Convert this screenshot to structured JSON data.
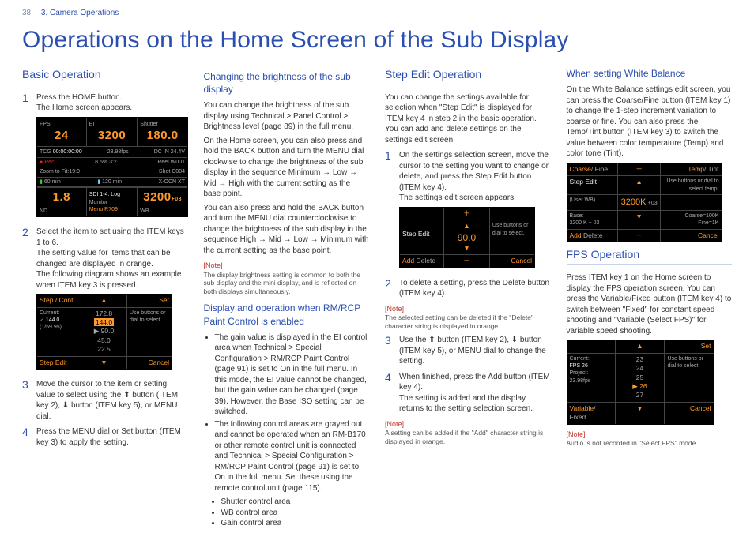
{
  "header": {
    "page": "38",
    "chapter": "3. Camera Operations"
  },
  "title": "Operations on the Home Screen of the Sub Display",
  "col1": {
    "h": "Basic Operation",
    "s1": {
      "n": "1",
      "a": "Press the HOME button.",
      "b": "The Home screen appears."
    },
    "lcd": {
      "fps_l": "FPS",
      "fps_v": "24",
      "ei_l": "EI",
      "ei_v": "3200",
      "sh_l": "Shutter",
      "sh_v": "180.0",
      "tcg": "TCG",
      "tc": "00:00:00:00",
      "fmt": "23.98fps",
      "dc": "DC IN 24.4V",
      "rec": "Rec",
      "gb": "8.6% 3:2",
      "zoom": "Zoom to Fit:19:9",
      "reel": "Reel W001",
      "shot": "Shot C004",
      "cache": "60 min",
      "play": "120 min",
      "xocn": "X-OCN XT",
      "nd_v": "1.8",
      "nd_l": "ND",
      "sdi": "SDI 1-4: Log",
      "lut": "Monitor",
      "menu": "Menu R709",
      "wb_v": "3200",
      "wb_off": "+03",
      "wb_l": "WB"
    },
    "s2": {
      "n": "2",
      "a": "Select the item to set using the ITEM keys 1 to 6.",
      "b": "The setting value for items that can be changed are displayed in orange.",
      "c": "The following diagram shows an example when ITEM key 3 is pressed."
    },
    "lcd2": {
      "tl": "Step / Cont.",
      "set": "Set",
      "cur": "Current:",
      "ang": "⊿ 144.0",
      "rate": "(1/59.95)",
      "v1": "172.8",
      "v2": "144.0",
      "v3": "90.0",
      "v4": "45.0",
      "v5": "22.5",
      "hint": "Use buttons or dial to select.",
      "se": "Step Edit",
      "cancel": "Cancel"
    },
    "s3": {
      "n": "3",
      "a": "Move the cursor to the item or setting value to select using the ⬆ button (ITEM key 2), ⬇ button (ITEM key 5), or MENU dial."
    },
    "s4": {
      "n": "4",
      "a": "Press the MENU dial or Set button (ITEM key 3) to apply the setting."
    }
  },
  "col2": {
    "h1": "Changing the brightness of the sub display",
    "p1": "You can change the brightness of the sub display using Technical > Panel Control > Brightness level (page 89) in the full menu.",
    "p2": "On the Home screen, you can also press and hold the BACK button and turn the MENU dial clockwise to change the brightness of the sub display in the sequence Minimum → Low → Mid → High with the current setting as the base point.",
    "p3": "You can also press and hold the BACK button and turn the MENU dial counterclockwise to change the brightness of the sub display in the sequence High → Mid → Low → Minimum with the current setting as the base point.",
    "noteL": "[Note]",
    "noteT": "The display brightness setting is common to both the sub display and the mini display, and is reflected on both displays simultaneously.",
    "h2": "Display and operation when RM/RCP Paint Control is enabled",
    "b1": "The gain value is displayed in the EI control area when Technical > Special Configuration > RM/RCP Paint Control (page 91) is set to On in the full menu. In this mode, the EI value cannot be changed, but the gain value can be changed (page 39). However, the Base ISO setting can be switched.",
    "b2": "The following control areas are grayed out and cannot be operated when an RM-B170 or other remote control unit is connected and Technical > Special Configuration > RM/RCP Paint Control (page 91) is set to On in the full menu. Set these using the remote control unit (page 115).",
    "bb1": "Shutter control area",
    "bb2": "WB control area",
    "bb3": "Gain control area"
  },
  "col3": {
    "h": "Step Edit Operation",
    "intro": "You can change the settings available for selection when \"Step Edit\" is displayed for ITEM key 4 in step 2 in the basic operation. You can add and delete settings on the settings edit screen.",
    "s1": {
      "n": "1",
      "a": "On the settings selection screen, move the cursor to the setting you want to change or delete, and press the Step Edit button (ITEM key 4).",
      "b": "The settings edit screen appears."
    },
    "lcd": {
      "tl": "Step Edit",
      "plus": "＋",
      "up": "▲",
      "v": "90.0",
      "dn": "▼",
      "hint": "Use buttons or dial to select.",
      "add": "Add",
      "del": "Delete",
      "minus": "－",
      "cancel": "Cancel"
    },
    "s2": {
      "n": "2",
      "a": "To delete a setting, press the Delete button (ITEM key 4)."
    },
    "noteL2": "[Note]",
    "noteT2": "The selected setting can be deleted if the \"Delete\" character string is displayed in orange.",
    "s3": {
      "n": "3",
      "a": "Use the ⬆ button (ITEM key 2), ⬇ button (ITEM key 5), or MENU dial to change the setting."
    },
    "s4": {
      "n": "4",
      "a": "When finished, press the Add button (ITEM key 4).",
      "b": "The setting is added and the display returns to the setting selection screen."
    },
    "noteL4": "[Note]",
    "noteT4": "A setting can be added if the \"Add\" character string is displayed in orange."
  },
  "col4": {
    "h1": "When setting White Balance",
    "p1": "On the White Balance settings edit screen, you can press the Coarse/Fine button (ITEM key 1) to change the 1-step increment variation to coarse or fine. You can also press the Temp/Tint button (ITEM key 3) to switch the value between color temperature (Temp) and color tone (Tint).",
    "lcd": {
      "cf": "Coarse",
      "cf2": "/ Fine",
      "plus": "＋",
      "tt": "Temp",
      "tt2": "/ Tint",
      "se": "Step Edit",
      "up": "▲",
      "hint": "Use buttons or dial to select temp.",
      "uw": "(User WB)",
      "val": "3200K",
      "off": "+03",
      "base": "Base:",
      "base2": "3200 K + 03",
      "dn": "▼",
      "cv": "Coarse=100K",
      "fv": "Fine=1K",
      "add": "Add",
      "del": "Delete",
      "minus": "－",
      "cancel": "Cancel"
    },
    "h2": "FPS Operation",
    "p2": "Press ITEM key 1 on the Home screen to display the FPS operation screen. You can press the Variable/Fixed button (ITEM key 4) to switch between \"Fixed\" for constant speed shooting and \"Variable (Select FPS)\" for variable speed shooting.",
    "lcd2": {
      "set": "Set",
      "cur": "Current:",
      "fps": "FPS 26",
      "proj": "Project:",
      "rate": "23.98fps",
      "v1": "23",
      "v2": "24",
      "v3": "25",
      "v4": "26",
      "v5": "27",
      "hint": "Use buttons or dial to select.",
      "vf": "Variable",
      "vf2": "/ Fixed",
      "cancel": "Cancel"
    },
    "noteL": "[Note]",
    "noteT": "Audio is not recorded in \"Select FPS\" mode."
  }
}
